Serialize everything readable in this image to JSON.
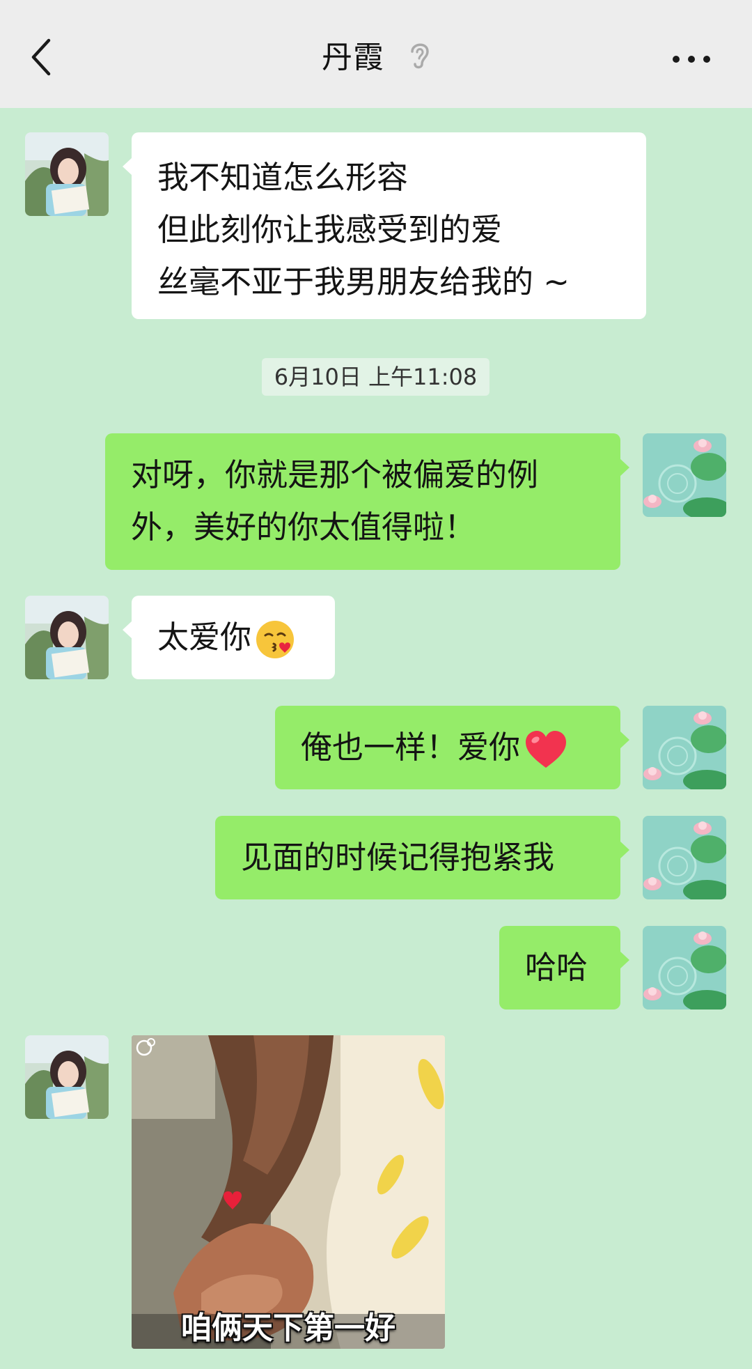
{
  "header": {
    "title": "丹霞",
    "back_icon": "chevron-left-icon",
    "ear_icon": "ear-icon",
    "more_icon": "more-icon"
  },
  "messages": [
    {
      "side": "incoming",
      "lines": [
        "我不知道怎么形容",
        "但此刻你让我感受到的爱",
        "丝毫不亚于我男朋友给我的 ~"
      ]
    },
    {
      "side": "outgoing",
      "lines": [
        "对呀，你就是那个被偏爱的例",
        "外，美好的你太值得啦！"
      ]
    },
    {
      "side": "incoming",
      "text": "太爱你",
      "emoji": "kissing-face-emoji"
    },
    {
      "side": "outgoing",
      "text": "俺也一样！爱你",
      "emoji": "red-heart-emoji"
    },
    {
      "side": "outgoing",
      "text": "见面的时候记得抱紧我"
    },
    {
      "side": "outgoing",
      "text": "哈哈"
    },
    {
      "side": "incoming",
      "type": "sticker",
      "caption": "咱俩天下第一好"
    }
  ],
  "timestamp": "6月10日 上午11:08",
  "colors": {
    "chat_background": "#c8ecd1",
    "header_background": "#ededed",
    "incoming_bubble": "#ffffff",
    "outgoing_bubble": "#95ec69"
  }
}
